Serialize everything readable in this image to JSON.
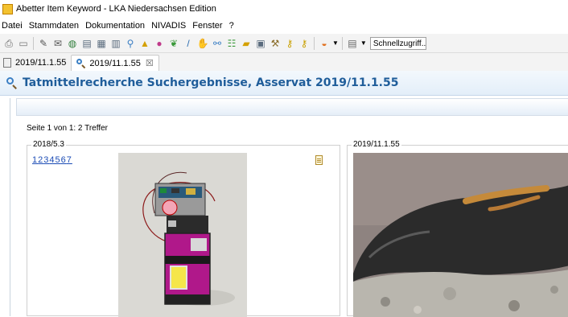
{
  "window": {
    "title": "Abetter Item Keyword - LKA Niedersachsen Edition"
  },
  "menu": {
    "items": [
      "Datei",
      "Stammdaten",
      "Dokumentation",
      "NIVADIS",
      "Fenster",
      "?"
    ]
  },
  "toolbar": {
    "quick_access": "Schnellzugriff..."
  },
  "tabs": [
    {
      "label": "2019/11.1.55"
    },
    {
      "label": "2019/11.1.55",
      "close": "☒"
    }
  ],
  "header": {
    "title": "Tatmittelrecherche Suchergebnisse, Asservat 2019/11.1.55"
  },
  "results": {
    "page_info": "Seite 1 von 1: 2 Treffer"
  },
  "cards": [
    {
      "label": "2018/5.3",
      "pages": [
        "1",
        "2",
        "3",
        "4",
        "5",
        "6",
        "7"
      ]
    },
    {
      "label": "2019/11.1.55"
    }
  ]
}
